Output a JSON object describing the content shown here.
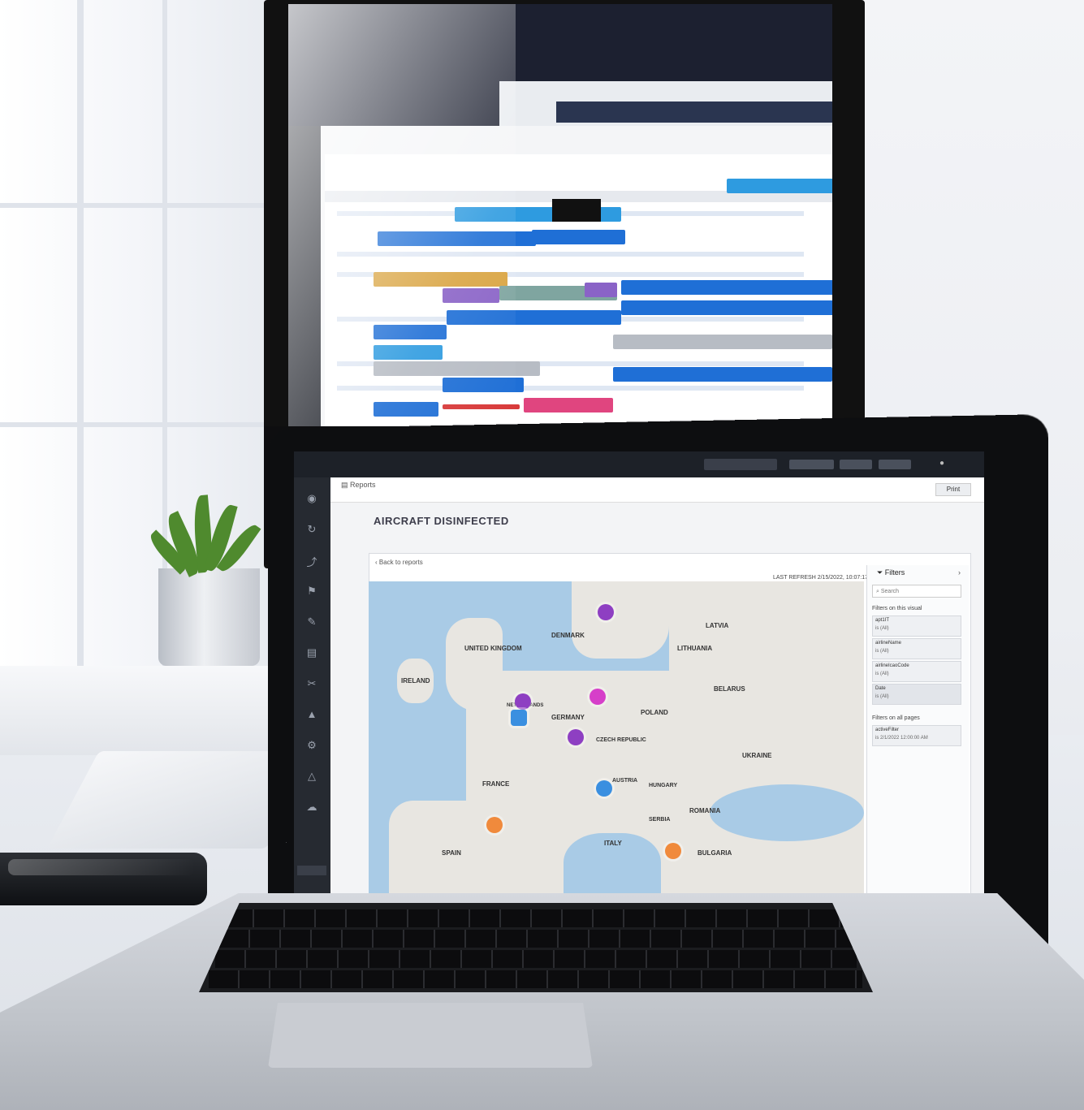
{
  "laptop_app": {
    "breadcrumb": "Reports",
    "page_title": "AIRCRAFT DISINFECTED",
    "back_link": "Back to reports",
    "refresh_label": "LAST REFRESH 2/15/2022, 10:07:17",
    "print_label": "Print",
    "filters": {
      "title": "Filters",
      "search_placeholder": "Search",
      "visual_heading": "Filters on this visual",
      "page_heading": "Filters on all pages",
      "items": [
        {
          "name": "apt1IT",
          "value": "is (All)"
        },
        {
          "name": "airlineName",
          "value": "is (All)"
        },
        {
          "name": "airlineIcaoCode",
          "value": "is (All)"
        },
        {
          "name": "Date",
          "value": "is (All)"
        }
      ],
      "page_items": [
        {
          "name": "activeFilter",
          "value": "is 2/1/2022 12:00:00 AM"
        }
      ]
    },
    "map": {
      "countries": [
        {
          "label": "UNITED KINGDOM"
        },
        {
          "label": "IRELAND"
        },
        {
          "label": "DENMARK"
        },
        {
          "label": "NETHERLANDS"
        },
        {
          "label": "GERMANY"
        },
        {
          "label": "POLAND"
        },
        {
          "label": "BELARUS"
        },
        {
          "label": "LITHUANIA"
        },
        {
          "label": "LATVIA"
        },
        {
          "label": "FRANCE"
        },
        {
          "label": "CZECH REPUBLIC"
        },
        {
          "label": "UKRAINE"
        },
        {
          "label": "AUSTRIA"
        },
        {
          "label": "HUNGARY"
        },
        {
          "label": "ROMANIA"
        },
        {
          "label": "ITALY"
        },
        {
          "label": "BULGARIA"
        },
        {
          "label": "SPAIN"
        },
        {
          "label": "SERBIA"
        }
      ],
      "marker_colors": {
        "purple": "#8e3fc2",
        "magenta": "#d63fc9",
        "blue": "#3a8fe0",
        "orange": "#f08a3c"
      }
    }
  },
  "colors": {
    "gantt_blue": "#1f6fd6",
    "gantt_light_blue": "#2e9be0",
    "gantt_gray": "#b7bcc4",
    "gantt_gold": "#d9a441",
    "gantt_purple": "#8a63c7",
    "gantt_pink": "#e0457f",
    "gantt_teal": "#4fa38a",
    "gantt_red": "#d83a3a",
    "app_dark": "#1d2128"
  }
}
